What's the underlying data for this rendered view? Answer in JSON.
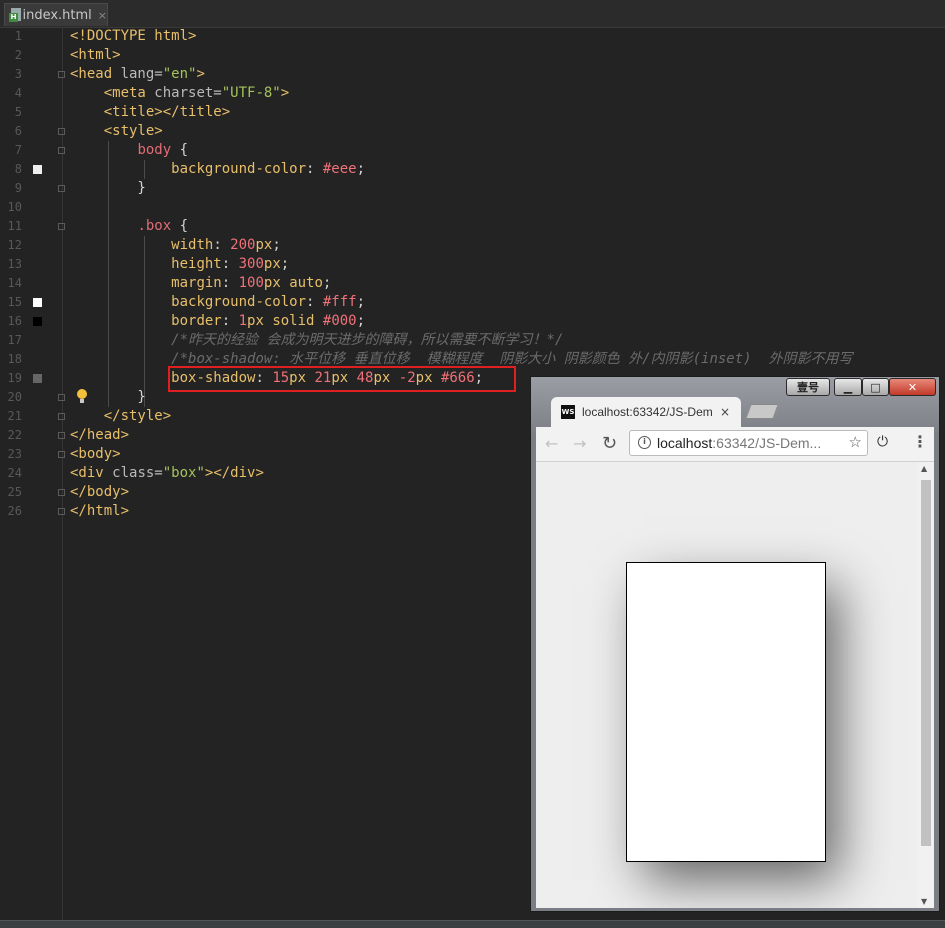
{
  "editor_tab": {
    "label": "index.html",
    "close": "×"
  },
  "lines": [
    {
      "n": "1",
      "tokens": [
        [
          "t-tag",
          "<!DOCTYPE html>"
        ]
      ]
    },
    {
      "n": "2",
      "tokens": [
        [
          "t-tag",
          "<html>"
        ]
      ]
    },
    {
      "n": "3",
      "tokens": [
        [
          "t-tag",
          "<head "
        ],
        [
          "t-attr",
          "lang="
        ],
        [
          "t-str",
          "\"en\""
        ],
        [
          "t-tag",
          ">"
        ]
      ]
    },
    {
      "n": "4",
      "tokens": [
        [
          "t-plain",
          "    "
        ],
        [
          "t-tag",
          "<meta "
        ],
        [
          "t-attr",
          "charset="
        ],
        [
          "t-str",
          "\"UTF-8\""
        ],
        [
          "t-tag",
          ">"
        ]
      ]
    },
    {
      "n": "5",
      "tokens": [
        [
          "t-plain",
          "    "
        ],
        [
          "t-tag",
          "<title></title>"
        ]
      ]
    },
    {
      "n": "6",
      "tokens": [
        [
          "t-plain",
          "    "
        ],
        [
          "t-tag",
          "<style>"
        ]
      ]
    },
    {
      "n": "7",
      "tokens": [
        [
          "t-plain",
          "        "
        ],
        [
          "t-sel",
          "body "
        ],
        [
          "t-plain",
          "{"
        ]
      ]
    },
    {
      "n": "8",
      "tokens": [
        [
          "t-plain",
          "            "
        ],
        [
          "t-prop",
          "background-color"
        ],
        [
          "t-plain",
          ": "
        ],
        [
          "t-hex",
          "#eee"
        ],
        [
          "t-plain",
          ";"
        ]
      ]
    },
    {
      "n": "9",
      "tokens": [
        [
          "t-plain",
          "        }"
        ]
      ]
    },
    {
      "n": "10",
      "tokens": []
    },
    {
      "n": "11",
      "tokens": [
        [
          "t-plain",
          "        "
        ],
        [
          "t-sel",
          ".box "
        ],
        [
          "t-plain",
          "{"
        ]
      ]
    },
    {
      "n": "12",
      "tokens": [
        [
          "t-plain",
          "            "
        ],
        [
          "t-prop",
          "width"
        ],
        [
          "t-plain",
          ": "
        ],
        [
          "t-num",
          "200"
        ],
        [
          "t-prop",
          "px"
        ],
        [
          "t-plain",
          ";"
        ]
      ]
    },
    {
      "n": "13",
      "tokens": [
        [
          "t-plain",
          "            "
        ],
        [
          "t-prop",
          "height"
        ],
        [
          "t-plain",
          ": "
        ],
        [
          "t-num",
          "300"
        ],
        [
          "t-prop",
          "px"
        ],
        [
          "t-plain",
          ";"
        ]
      ]
    },
    {
      "n": "14",
      "tokens": [
        [
          "t-plain",
          "            "
        ],
        [
          "t-prop",
          "margin"
        ],
        [
          "t-plain",
          ": "
        ],
        [
          "t-num",
          "100"
        ],
        [
          "t-prop",
          "px "
        ],
        [
          "t-prop",
          "auto"
        ],
        [
          "t-plain",
          ";"
        ]
      ]
    },
    {
      "n": "15",
      "tokens": [
        [
          "t-plain",
          "            "
        ],
        [
          "t-prop",
          "background-color"
        ],
        [
          "t-plain",
          ": "
        ],
        [
          "t-hex",
          "#fff"
        ],
        [
          "t-plain",
          ";"
        ]
      ]
    },
    {
      "n": "16",
      "tokens": [
        [
          "t-plain",
          "            "
        ],
        [
          "t-prop",
          "border"
        ],
        [
          "t-plain",
          ": "
        ],
        [
          "t-num",
          "1"
        ],
        [
          "t-prop",
          "px solid "
        ],
        [
          "t-hex",
          "#000"
        ],
        [
          "t-plain",
          ";"
        ]
      ]
    },
    {
      "n": "17",
      "tokens": [
        [
          "t-plain",
          "            "
        ],
        [
          "t-cmt",
          "/*昨天的经验 会成为明天进步的障碍，所以需要不断学习！*/"
        ]
      ]
    },
    {
      "n": "18",
      "tokens": [
        [
          "t-plain",
          "            "
        ],
        [
          "t-cmt",
          "/*box-shadow: 水平位移 垂直位移  模糊程度  阴影大小 阴影颜色 外/内阴影(inset)  外阴影不用写"
        ]
      ]
    },
    {
      "n": "19",
      "tokens": [
        [
          "t-plain",
          "            "
        ],
        [
          "t-prop",
          "box-shadow"
        ],
        [
          "t-plain",
          ": "
        ],
        [
          "t-num",
          "15"
        ],
        [
          "t-prop",
          "px "
        ],
        [
          "t-num",
          "21"
        ],
        [
          "t-prop",
          "px "
        ],
        [
          "t-num",
          "48"
        ],
        [
          "t-prop",
          "px "
        ],
        [
          "t-num",
          "-2"
        ],
        [
          "t-prop",
          "px "
        ],
        [
          "t-hex",
          "#666"
        ],
        [
          "t-plain",
          ";"
        ]
      ]
    },
    {
      "n": "20",
      "tokens": [
        [
          "t-plain",
          "        }"
        ]
      ]
    },
    {
      "n": "21",
      "tokens": [
        [
          "t-plain",
          "    "
        ],
        [
          "t-tag",
          "</style>"
        ]
      ]
    },
    {
      "n": "22",
      "tokens": [
        [
          "t-tag",
          "</head>"
        ]
      ]
    },
    {
      "n": "23",
      "tokens": [
        [
          "t-tag",
          "<body>"
        ]
      ]
    },
    {
      "n": "24",
      "tokens": [
        [
          "t-tag",
          "<div "
        ],
        [
          "t-attr",
          "class="
        ],
        [
          "t-str",
          "\"box\""
        ],
        [
          "t-tag",
          "></div>"
        ]
      ]
    },
    {
      "n": "25",
      "tokens": [
        [
          "t-tag",
          "</body>"
        ]
      ]
    },
    {
      "n": "26",
      "tokens": [
        [
          "t-tag",
          "</html>"
        ]
      ]
    }
  ],
  "gutter_swatches": [
    {
      "line": "8",
      "color": "#eeeeee"
    },
    {
      "line": "15",
      "color": "#ffffff"
    },
    {
      "line": "16",
      "color": "#000000"
    },
    {
      "line": "19",
      "color": "#666666"
    }
  ],
  "browser": {
    "user_button": "壹号",
    "min": "▁",
    "max": "□",
    "close": "✕",
    "tab_title": "localhost:63342/JS-Dem",
    "tab_close": "×",
    "ws_icon_text": "WS",
    "back": "←",
    "forward": "→",
    "reload": "↻",
    "url_prefix": "localhost",
    "url_rest": ":63342/JS-Dem...",
    "star": "☆",
    "power": "⏻",
    "menu": "⋮"
  }
}
